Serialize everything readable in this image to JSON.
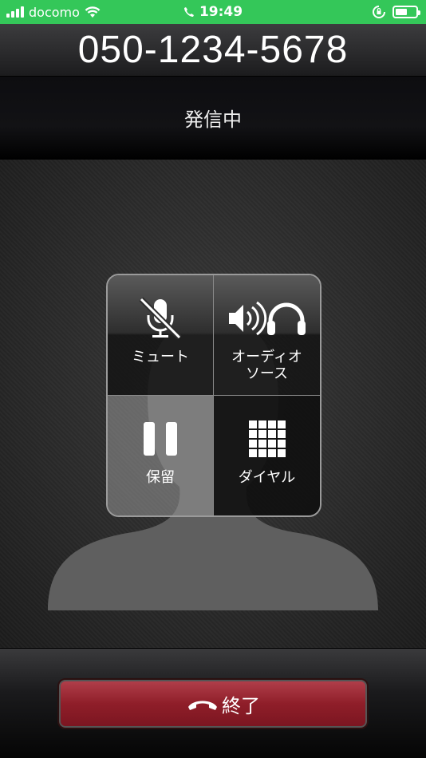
{
  "status_bar": {
    "carrier": "docomo",
    "time": "19:49"
  },
  "call": {
    "number": "050-1234-5678",
    "state": "発信中"
  },
  "controls": [
    {
      "label": "ミュート",
      "icon": "mic-muted-icon"
    },
    {
      "label": "オーディオ\nソース",
      "icon": "speaker-headphones-icon"
    },
    {
      "label": "保留",
      "icon": "pause-icon"
    },
    {
      "label": "ダイヤル",
      "icon": "keypad-icon"
    }
  ],
  "end_call": {
    "label": "終了",
    "color": "#9a2a35"
  },
  "colors": {
    "status_bar": "#34c759"
  }
}
